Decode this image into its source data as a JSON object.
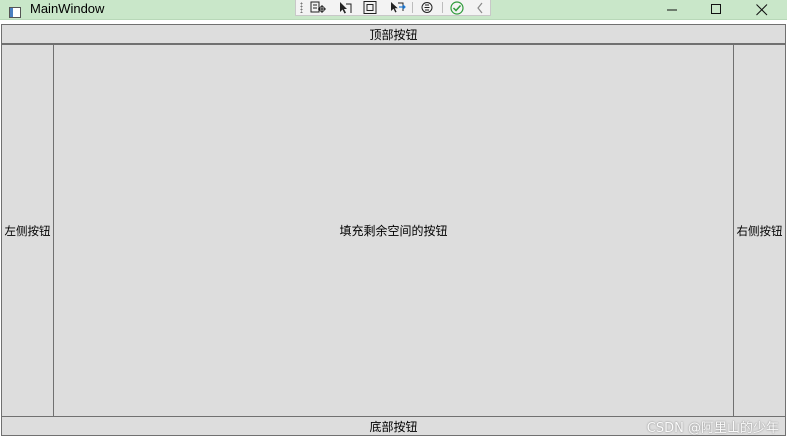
{
  "window": {
    "title": "MainWindow",
    "titlebar_color": "#c9e7c9"
  },
  "debug_toolbar": {
    "items": [
      "select-element-icon",
      "select-element-pointer-icon",
      "display-layout-adorners-icon",
      "track-focused-element-icon",
      "hot-reload-icon",
      "hot-reload-ok-icon",
      "collapse-toolbar-icon"
    ]
  },
  "window_controls": [
    "minimize-icon",
    "maximize-icon",
    "close-icon"
  ],
  "buttons": {
    "top": "顶部按钮",
    "left": "左侧按钮",
    "fill": "填充剩余空间的按钮",
    "right": "右侧按钮",
    "bottom": "底部按钮"
  },
  "button_colors": {
    "background": "#dddddd",
    "border": "#707070"
  },
  "watermark": "CSDN @阿里山的少年"
}
